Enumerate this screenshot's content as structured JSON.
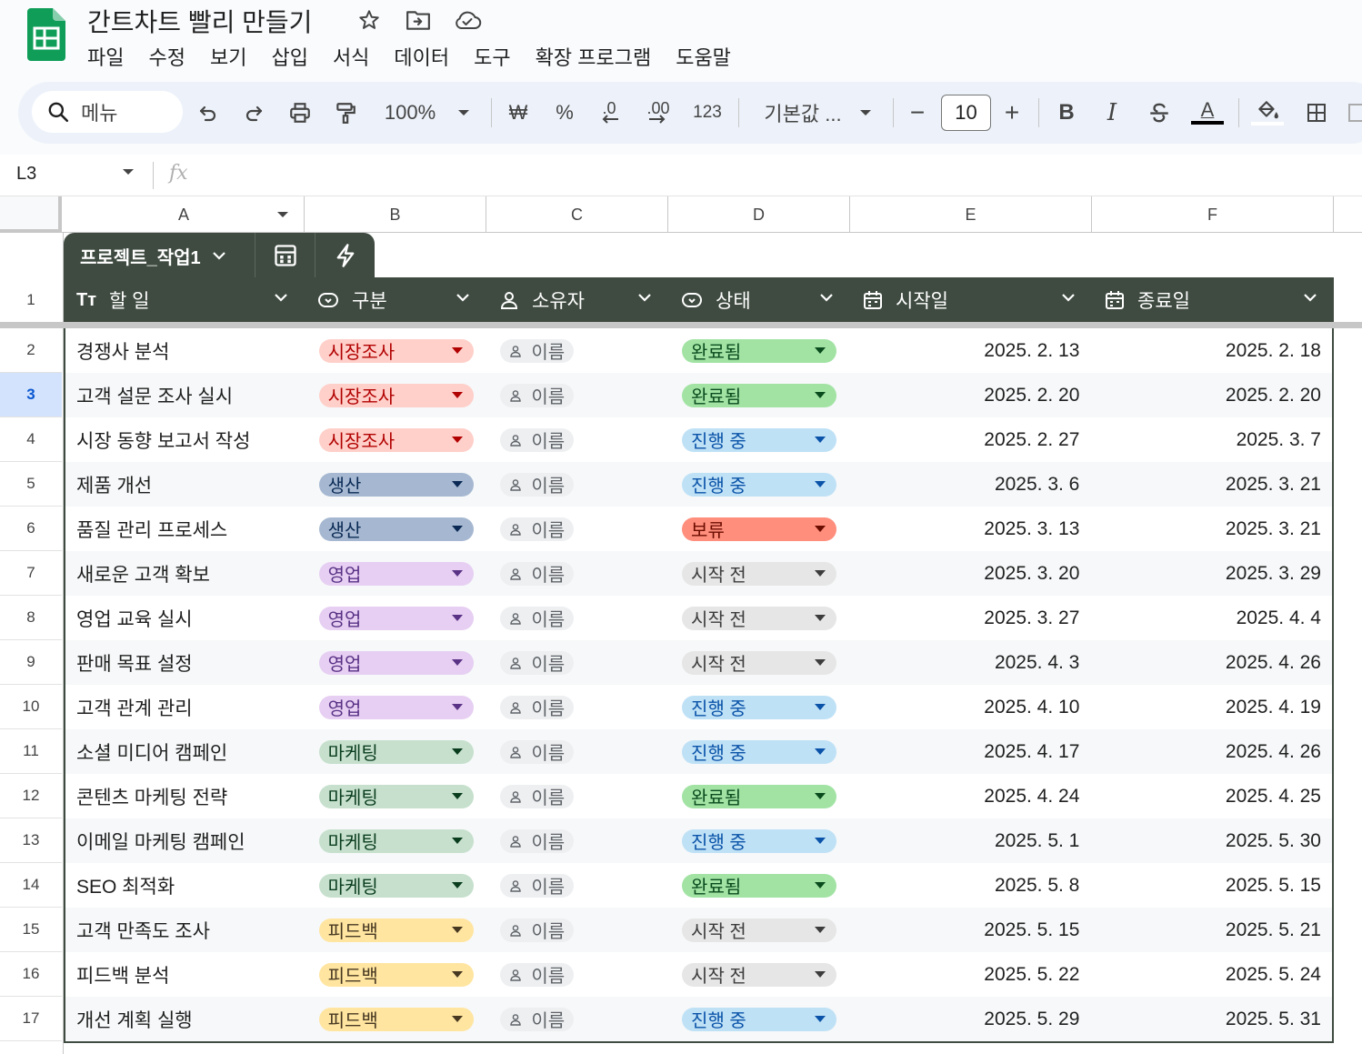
{
  "doc": {
    "title": "간트차트 빨리 만들기"
  },
  "menu": [
    "파일",
    "수정",
    "보기",
    "삽입",
    "서식",
    "데이터",
    "도구",
    "확장 프로그램",
    "도움말"
  ],
  "toolbar": {
    "search_label": "메뉴",
    "zoom": "100%",
    "currency": "₩",
    "percent": "%",
    "dec_decrease": ".0",
    "dec_increase": ".00",
    "number_format": "123",
    "font": "기본값 ...",
    "font_size": "10",
    "minus": "−",
    "plus": "+",
    "bold": "B",
    "italic": "I",
    "text_color_letter": "A"
  },
  "formula_bar": {
    "cell": "L3",
    "fx": "fx"
  },
  "columns": [
    "A",
    "B",
    "C",
    "D",
    "E",
    "F"
  ],
  "table": {
    "name": "프로젝트_작업1",
    "headers": [
      "할 일",
      "구분",
      "소유자",
      "상태",
      "시작일",
      "종료일"
    ],
    "header_icons": [
      "text-type-icon",
      "dropdown-chip-icon",
      "person-icon",
      "dropdown-chip-icon",
      "calendar-icon",
      "calendar-icon"
    ],
    "header_glyph_text": "Tт",
    "category_colors": {
      "시장조사": {
        "bg": "#ffcfc9",
        "fg": "#b10202"
      },
      "생산": {
        "bg": "#a6b8d1",
        "fg": "#0a2a55"
      },
      "영업": {
        "bg": "#e6cff2",
        "fg": "#5a3286"
      },
      "마케팅": {
        "bg": "#c6e0cd",
        "fg": "#0a3d1e"
      },
      "피드백": {
        "bg": "#ffe5a0",
        "fg": "#473822"
      }
    },
    "status_colors": {
      "완료됨": {
        "bg": "#a2e3a4",
        "fg": "#0a4b1e"
      },
      "진행 중": {
        "bg": "#bfe1f6",
        "fg": "#0a53a8"
      },
      "보류": {
        "bg": "#ff8e7c",
        "fg": "#6b0c00"
      },
      "시작 전": {
        "bg": "#e6e6e6",
        "fg": "#3c3c3c"
      }
    },
    "owner_placeholder": "이름",
    "rows": [
      {
        "num": "2",
        "task": "경쟁사 분석",
        "category": "시장조사",
        "status": "완료됨",
        "start": "2025. 2. 13",
        "end": "2025. 2. 18"
      },
      {
        "num": "3",
        "task": "고객 설문 조사 실시",
        "category": "시장조사",
        "status": "완료됨",
        "start": "2025. 2. 20",
        "end": "2025. 2. 20"
      },
      {
        "num": "4",
        "task": "시장 동향 보고서 작성",
        "category": "시장조사",
        "status": "진행 중",
        "start": "2025. 2. 27",
        "end": "2025. 3. 7"
      },
      {
        "num": "5",
        "task": "제품 개선",
        "category": "생산",
        "status": "진행 중",
        "start": "2025. 3. 6",
        "end": "2025. 3. 21"
      },
      {
        "num": "6",
        "task": "품질 관리 프로세스",
        "category": "생산",
        "status": "보류",
        "start": "2025. 3. 13",
        "end": "2025. 3. 21"
      },
      {
        "num": "7",
        "task": "새로운 고객 확보",
        "category": "영업",
        "status": "시작 전",
        "start": "2025. 3. 20",
        "end": "2025. 3. 29"
      },
      {
        "num": "8",
        "task": "영업 교육 실시",
        "category": "영업",
        "status": "시작 전",
        "start": "2025. 3. 27",
        "end": "2025. 4. 4"
      },
      {
        "num": "9",
        "task": "판매 목표 설정",
        "category": "영업",
        "status": "시작 전",
        "start": "2025. 4. 3",
        "end": "2025. 4. 26"
      },
      {
        "num": "10",
        "task": "고객 관계 관리",
        "category": "영업",
        "status": "진행 중",
        "start": "2025. 4. 10",
        "end": "2025. 4. 19"
      },
      {
        "num": "11",
        "task": "소셜 미디어 캠페인",
        "category": "마케팅",
        "status": "진행 중",
        "start": "2025. 4. 17",
        "end": "2025. 4. 26"
      },
      {
        "num": "12",
        "task": "콘텐츠 마케팅 전략",
        "category": "마케팅",
        "status": "완료됨",
        "start": "2025. 4. 24",
        "end": "2025. 4. 25"
      },
      {
        "num": "13",
        "task": "이메일 마케팅 캠페인",
        "category": "마케팅",
        "status": "진행 중",
        "start": "2025. 5. 1",
        "end": "2025. 5. 30"
      },
      {
        "num": "14",
        "task": "SEO 최적화",
        "category": "마케팅",
        "status": "완료됨",
        "start": "2025. 5. 8",
        "end": "2025. 5. 15"
      },
      {
        "num": "15",
        "task": "고객 만족도 조사",
        "category": "피드백",
        "status": "시작 전",
        "start": "2025. 5. 15",
        "end": "2025. 5. 21"
      },
      {
        "num": "16",
        "task": "피드백 분석",
        "category": "피드백",
        "status": "시작 전",
        "start": "2025. 5. 22",
        "end": "2025. 5. 24"
      },
      {
        "num": "17",
        "task": "개선 계획 실행",
        "category": "피드백",
        "status": "진행 중",
        "start": "2025. 5. 29",
        "end": "2025. 5. 31"
      }
    ],
    "selected_row": "3"
  },
  "colors": {
    "accent": "#0b57d0",
    "table_header": "#3f4b41",
    "sheets_green": "#0f9d58"
  }
}
